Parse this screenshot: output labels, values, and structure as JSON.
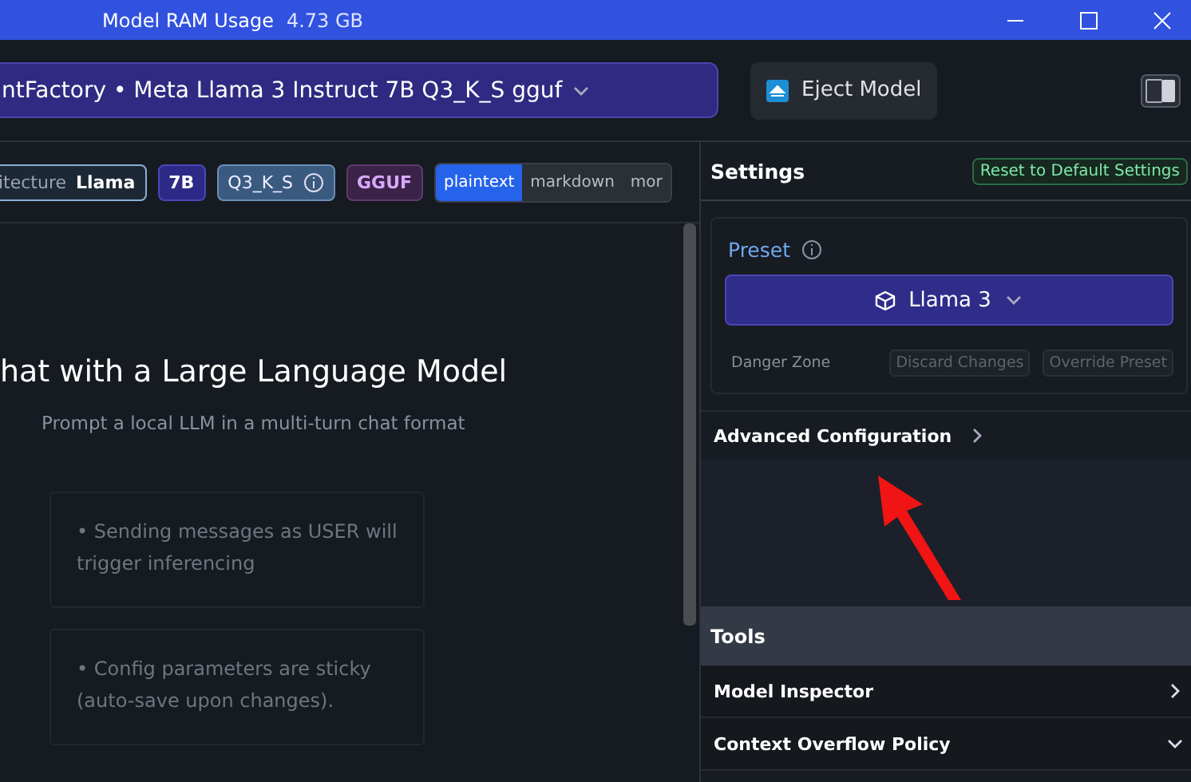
{
  "window": {
    "title": "Model RAM Usage",
    "ram": "4.73 GB",
    "controls": [
      {
        "kind": "minimize"
      },
      {
        "kind": "maximize"
      },
      {
        "kind": "close"
      }
    ]
  },
  "toolbar": {
    "model": "ntFactory • Meta Llama 3 Instruct 7B Q3_K_S gguf",
    "eject": "Eject Model"
  },
  "tags": [
    {
      "kind": "arch",
      "label": "itecture",
      "value": "Llama"
    },
    {
      "kind": "size",
      "label": "7B"
    },
    {
      "kind": "quant",
      "label": "Q3_K_S"
    },
    {
      "kind": "format",
      "label": "GGUF"
    }
  ],
  "format_tabs": [
    {
      "label": "plaintext",
      "selected": true
    },
    {
      "label": "markdown",
      "selected": false
    },
    {
      "label": "mor",
      "selected": false
    }
  ],
  "chat": {
    "heading": "hat with a Large Language Model",
    "subtitle": "Prompt a local LLM in a multi-turn chat format",
    "tips": [
      "• Sending messages as USER will trigger inferencing",
      "• Config parameters are sticky (auto-save upon changes)."
    ]
  },
  "settings": {
    "title": "Settings",
    "reset": "Reset to Default Settings",
    "preset_label": "Preset",
    "preset": "Llama 3",
    "danger_zone": "Danger Zone",
    "danger_buttons": [
      {
        "label": "Discard Changes",
        "disabled": true
      },
      {
        "label": "Override Preset",
        "disabled": true
      }
    ],
    "advanced": {
      "label": "Advanced Configuration",
      "expanded": false
    }
  },
  "tools": {
    "title": "Tools",
    "items": [
      {
        "label": "Model Inspector",
        "expanded": false
      },
      {
        "label": "Context Overflow Policy",
        "expanded": true
      }
    ]
  },
  "annotations": [
    {
      "kind": "arrow"
    }
  ]
}
